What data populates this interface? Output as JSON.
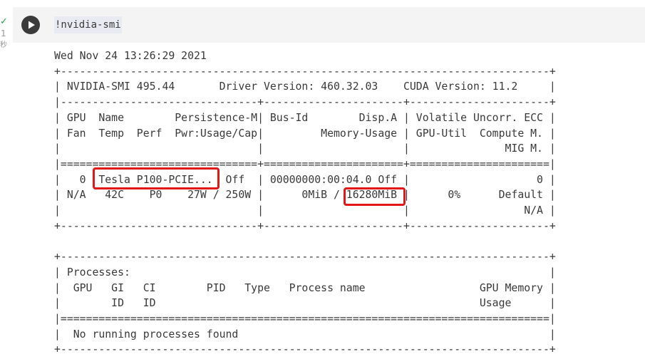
{
  "gutter": {
    "status_glyph": "✓",
    "exec_count": "1",
    "exec_unit": "秒"
  },
  "cell": {
    "code": "!nvidia-smi"
  },
  "output": {
    "timestamp": "Wed Nov 24 13:26:29 2021",
    "lines": [
      "+-----------------------------------------------------------------------------+",
      "| NVIDIA-SMI 495.44       Driver Version: 460.32.03    CUDA Version: 11.2     |",
      "|-------------------------------+----------------------+----------------------+",
      "| GPU  Name        Persistence-M| Bus-Id        Disp.A | Volatile Uncorr. ECC |",
      "| Fan  Temp  Perf  Pwr:Usage/Cap|         Memory-Usage | GPU-Util  Compute M. |",
      "|                               |                      |               MIG M. |",
      "|===============================+======================+======================|",
      "|   0  Tesla P100-PCIE...  Off  | 00000000:00:04.0 Off |                    0 |",
      "| N/A   42C    P0    27W / 250W |      0MiB / 16280MiB |      0%      Default |",
      "|                               |                      |                  N/A |",
      "+-------------------------------+----------------------+----------------------+",
      "",
      "+-----------------------------------------------------------------------------+",
      "| Processes:                                                                  |",
      "|  GPU   GI   CI        PID   Type   Process name                  GPU Memory |",
      "|        ID   ID                                                   Usage      |",
      "|=============================================================================|",
      "|  No running processes found                                                 |",
      "+-----------------------------------------------------------------------------+"
    ]
  },
  "highlights": {
    "gpu_name": "Tesla P100-PCIE...",
    "total_memory": "16280MiB",
    "color": "#e01818"
  },
  "theme": {
    "input_bg": "#f4f4f4",
    "text_color": "#3a3a3a",
    "run_button_bg": "#3b3b3b",
    "check_color": "#2e9e4f"
  }
}
